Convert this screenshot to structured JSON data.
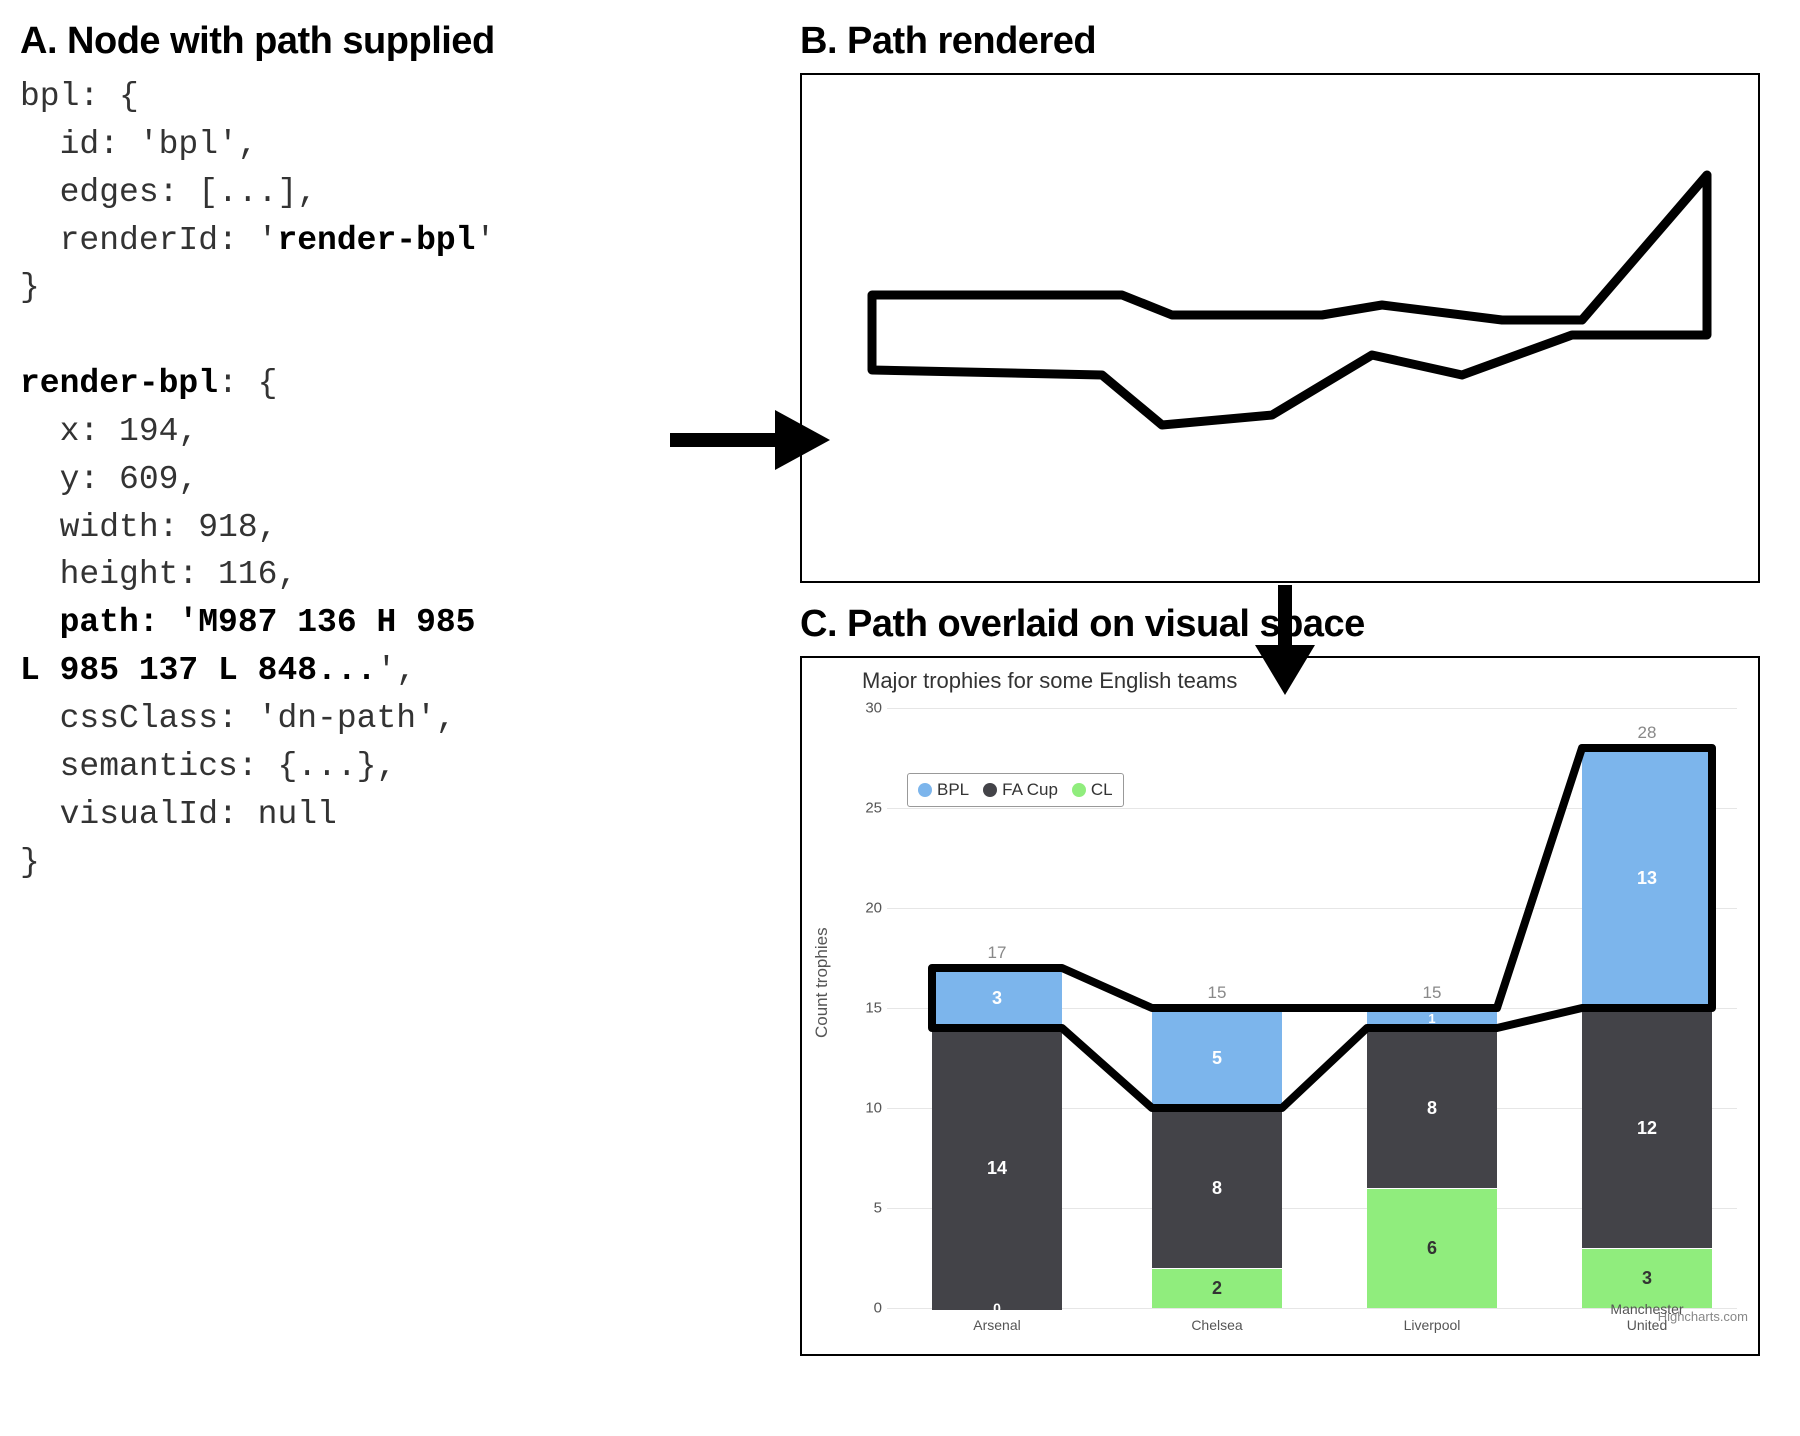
{
  "panelA": {
    "heading": "A. Node with path supplied",
    "code": {
      "line1": "bpl: {",
      "line2": "  id: 'bpl',",
      "line3": "  edges: [...],",
      "line4_pre": "  renderId: '",
      "line4_bold": "render-bpl",
      "line4_post": "'",
      "line5": "}",
      "blank": "",
      "line6_bold": "render-bpl",
      "line6_post": ": {",
      "line7": "  x: 194,",
      "line8": "  y: 609,",
      "line9": "  width: 918,",
      "line10": "  height: 116,",
      "line11_pre": "  ",
      "line11_bold": "path: 'M987 136 H 985",
      "line12_bold": "L 985 137 L 848...",
      "line12_post": "',",
      "line13": "  cssClass: 'dn-path',",
      "line14": "  semantics: {...},",
      "line15": "  visualId: null",
      "line16": "}"
    }
  },
  "panelB": {
    "heading": "B. Path rendered"
  },
  "panelC": {
    "heading": "C. Path overlaid on visual space",
    "chart_title": "Major trophies for some English teams",
    "y_label": "Count trophies",
    "credit": "Highcharts.com",
    "legend": {
      "bpl": "BPL",
      "facup": "FA Cup",
      "cl": "CL"
    },
    "y_ticks": {
      "t0": "0",
      "t5": "5",
      "t10": "10",
      "t15": "15",
      "t20": "20",
      "t25": "25",
      "t30": "30"
    },
    "x_ticks": {
      "c0": "Arsenal",
      "c1": "Chelsea",
      "c2": "Liverpool",
      "c3": "Manchester United"
    },
    "totals": {
      "c0": "17",
      "c1": "15",
      "c2": "15",
      "c3": "28"
    },
    "labels": {
      "c0_bpl": "3",
      "c0_fa": "14",
      "c0_cl": "0",
      "c1_bpl": "5",
      "c1_fa": "8",
      "c1_cl": "2",
      "c2_bpl": "1",
      "c2_fa": "8",
      "c2_cl": "6",
      "c3_bpl": "13",
      "c3_fa": "12",
      "c3_cl": "3"
    }
  },
  "chart_data": {
    "type": "bar",
    "stacked": true,
    "title": "Major trophies for some English teams",
    "xlabel": "",
    "ylabel": "Count trophies",
    "categories": [
      "Arsenal",
      "Chelsea",
      "Liverpool",
      "Manchester United"
    ],
    "series": [
      {
        "name": "BPL",
        "color": "#7cb5ec",
        "values": [
          3,
          5,
          1,
          13
        ]
      },
      {
        "name": "FA Cup",
        "color": "#434348",
        "values": [
          14,
          8,
          8,
          12
        ]
      },
      {
        "name": "CL",
        "color": "#90ed7d",
        "values": [
          0,
          2,
          6,
          3
        ]
      }
    ],
    "totals": [
      17,
      15,
      15,
      28
    ],
    "ylim": [
      0,
      30
    ],
    "y_tick_interval": 5,
    "credit": "Highcharts.com"
  }
}
